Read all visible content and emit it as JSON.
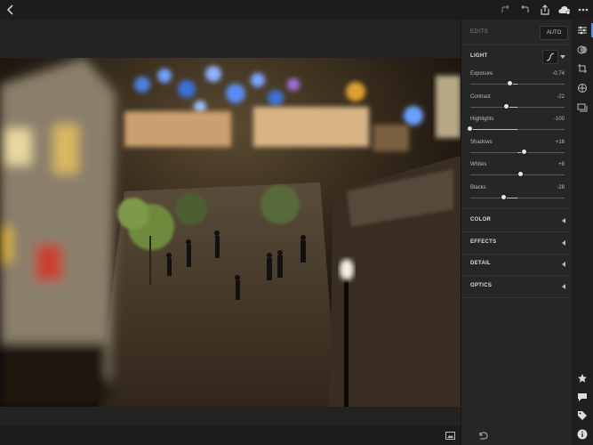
{
  "toolbar": {
    "back_icon": "chevron-left-icon",
    "right_icons": [
      "redo-icon",
      "undo-icon",
      "share-icon",
      "cloud-sync-icon",
      "more-icon"
    ]
  },
  "panel": {
    "edits_label": "EDITS",
    "auto_label": "AUTO",
    "light": {
      "title": "LIGHT",
      "sliders": [
        {
          "label": "Exposure",
          "value": "-0.74",
          "level": -0.148
        },
        {
          "label": "Contrast",
          "value": "-22",
          "level": -0.22
        },
        {
          "label": "Highlights",
          "value": "-100",
          "level": -1.0
        },
        {
          "label": "Shadows",
          "value": "+16",
          "level": 0.16
        },
        {
          "label": "Whites",
          "value": "+8",
          "level": 0.08
        },
        {
          "label": "Blacks",
          "value": "-28",
          "level": -0.28
        }
      ]
    },
    "sections": [
      "COLOR",
      "EFFECTS",
      "DETAIL",
      "OPTICS"
    ]
  },
  "rail": {
    "top_icons": [
      "sliders-icon",
      "presets-icon",
      "crop-icon",
      "healing-icon",
      "versions-icon"
    ],
    "bottom_icons": [
      "star-icon",
      "comment-icon",
      "tag-icon",
      "info-icon"
    ]
  },
  "bottom": {
    "left_icon": "compare-icon",
    "right_icon": "reset-icon"
  },
  "colors": {
    "background": "#1e1e1e",
    "panel": "#262626",
    "accent_thumb": "#e6e6e6"
  }
}
